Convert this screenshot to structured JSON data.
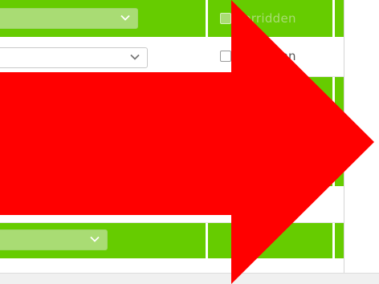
{
  "form_rows": [
    {
      "checkbox_label": "verridden"
    },
    {
      "checkbox_label": "verridden"
    }
  ],
  "colors": {
    "row_green": "#66cc00",
    "select_green": "#a9dc74",
    "arrow_red": "#ff0000"
  },
  "icons": {
    "dropdown": "chevron-down-icon",
    "overlay": "right-arrow-icon"
  }
}
